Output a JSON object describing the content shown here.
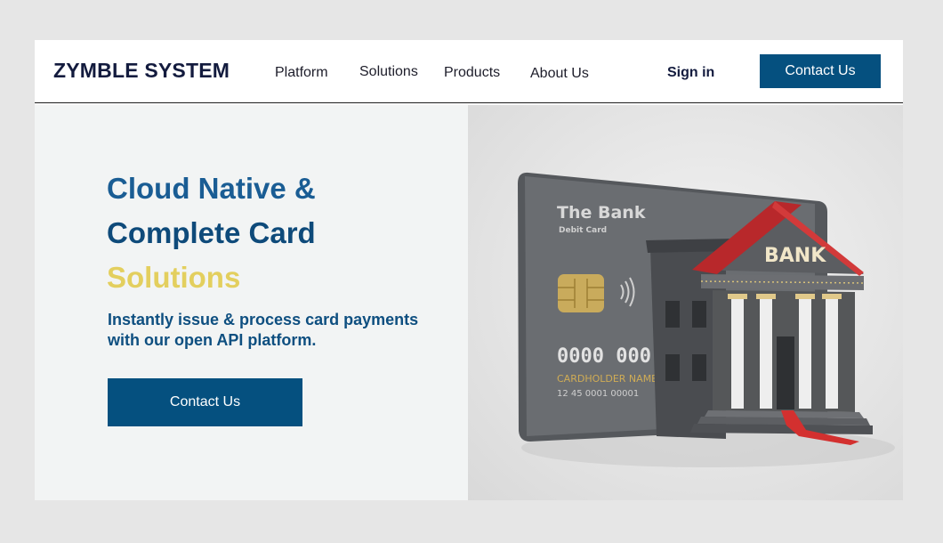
{
  "brand": {
    "name": "ZYMBLE SYSTEM"
  },
  "nav": {
    "items": [
      {
        "label": "Platform"
      },
      {
        "label": "Solutions"
      },
      {
        "label": "Products"
      },
      {
        "label": "About Us"
      }
    ],
    "signin_label": "Sign in",
    "contact_label": "Contact Us"
  },
  "hero": {
    "title_line1": "Cloud Native &",
    "title_line2": "Complete Card",
    "title_line3": "Solutions",
    "subtitle": "Instantly issue & process card payments with our open API platform.",
    "cta_label": "Contact Us",
    "image": {
      "card_bank_name": "The Bank",
      "card_type": "Debit Card",
      "card_number_partial": "0000 000",
      "cardholder_label": "CARDHOLDER NAME",
      "card_small_number": "12 45 0001 00001",
      "building_sign": "BANK"
    }
  },
  "colors": {
    "primary": "#05507f",
    "title_blue": "#1a5d94",
    "accent_yellow": "#e3cf5e",
    "background": "#e6e6e6"
  }
}
